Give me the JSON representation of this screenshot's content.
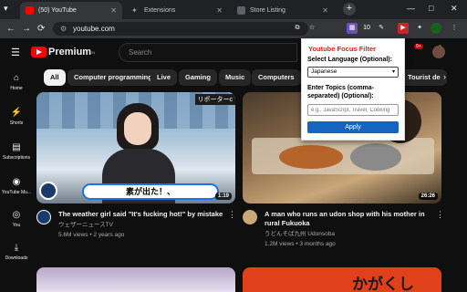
{
  "browser": {
    "tabs": [
      {
        "label": "(50) YouTube"
      },
      {
        "label": "Extensions"
      },
      {
        "label": "Store Listing"
      }
    ],
    "new_tab": "+",
    "url": "youtube.com",
    "nav": {
      "back": "←",
      "forward": "→",
      "reload": "⟳"
    },
    "window": {
      "minimize": "—",
      "maximize": "□",
      "close": "✕"
    },
    "ext_badge": "10"
  },
  "youtube": {
    "logo_text": "Premium",
    "logo_sup": "IN",
    "search_placeholder": "Search",
    "notif_count": "9+",
    "chips": [
      "All",
      "Computer programming",
      "Live",
      "Gaming",
      "Music",
      "Computers",
      "Tourist de"
    ],
    "sidebar": [
      {
        "label": "Home",
        "icon": "⌂"
      },
      {
        "label": "Shorts",
        "icon": "⚡"
      },
      {
        "label": "Subscriptions",
        "icon": "▤"
      },
      {
        "label": "YouTube Mu...",
        "icon": "◉"
      },
      {
        "label": "You",
        "icon": "◎"
      },
      {
        "label": "Downloads",
        "icon": "⤓"
      }
    ],
    "videos": [
      {
        "title": "The weather girl said \"It's fucking hot!\" by mistake",
        "channel": "ウェザーニュースTV",
        "meta": "5.6M views • 2 years ago",
        "duration": "1:19",
        "caption": "素が出た！、",
        "overlay": "リポーターc"
      },
      {
        "title_line1": "A man who runs an udon shop with his mother in",
        "title_line2": "rural Fukuoka",
        "channel": "うどんそば九州 Udonsoba",
        "meta": "1.2M views • 3 months ago",
        "duration": "26:26"
      }
    ],
    "bottom_thumb_text": "かがくし"
  },
  "popup": {
    "title": "Youtube Focus Filter",
    "lang_label": "Select Language (Optional):",
    "lang_value": "Japanese",
    "topics_label_1": "Enter Topics (comma-",
    "topics_label_2": "separated) (Optional):",
    "topics_placeholder": "e.g., JavaScript, Travel, Cooking",
    "apply_label": "Apply"
  },
  "colors": {
    "yt_red": "#ff0000",
    "popup_title": "#e62117",
    "apply_bg": "#1565c0"
  }
}
